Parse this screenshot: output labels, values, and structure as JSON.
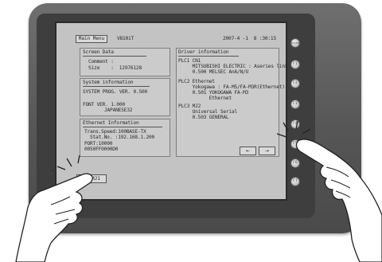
{
  "screen": {
    "menu_button": "Main Menu",
    "model": "V810iT",
    "datetime": "2007-4 -1  8 :30:15",
    "screen_data": {
      "title": "Screen Data",
      "comment": "Comment :",
      "size": "Size    :  12976128"
    },
    "system_info": {
      "title": "System information",
      "prog_ver": "SYSTEM PROG. VER. 0.500",
      "font_ver": "FONT VER. 1.000",
      "font_lang": "JAPANESE32"
    },
    "ethernet": {
      "title": "Ethernet Information",
      "speed": "Trans.Speed:100BASE-TX",
      "station": "Stat.No. :192.168.1.200",
      "port": "PORT:10000",
      "mac": "0050FF0000D0"
    },
    "driver": {
      "title": "Driver information",
      "plc1": [
        "PLC1 CN1",
        "     MITSUBISHI ELECTRIC : Aseries link",
        "     0.500 MELSEC AnA/N/U"
      ],
      "plc2": [
        "PLC2 Ethernet",
        "     Yokogawa : FA-M5/FA-M3R(Ethernet)",
        "     0.501 YOKOGAWA FA-M3",
        "           Ethernet"
      ],
      "plc3": [
        "PLC3 MJ2",
        "     Universal Serial",
        "     0.503 GENERAL"
      ]
    },
    "nav": {
      "prev": "←",
      "next": "→"
    },
    "bottom_button": "Ex(MJ1"
  },
  "function_keys": [
    "SYSTEM",
    "F1",
    "F2",
    "F3",
    "F4",
    "F5",
    "F6",
    "F7"
  ],
  "colors": {
    "screen_bg": "#c3c3c3",
    "bezel": "#565656"
  }
}
